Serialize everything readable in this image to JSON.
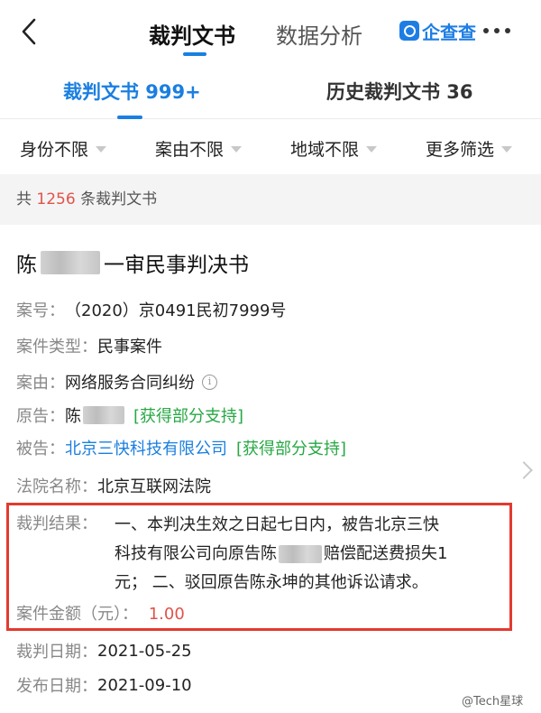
{
  "header": {
    "tabs": [
      {
        "label": "裁判文书"
      },
      {
        "label": "数据分析"
      }
    ],
    "logo_text": "企查查",
    "accent_color": "#1a7fe0"
  },
  "subtabs": [
    {
      "label": "裁判文书 999+"
    },
    {
      "label": "历史裁判文书 36"
    }
  ],
  "filters": [
    {
      "label": "身份不限"
    },
    {
      "label": "案由不限"
    },
    {
      "label": "地域不限"
    },
    {
      "label": "更多筛选"
    }
  ],
  "count_bar": {
    "prefix": "共",
    "count": "1256",
    "suffix": "条裁判文书"
  },
  "card": {
    "title_prefix": "陈",
    "title_suffix": "一审民事判决书",
    "case_no": {
      "label": "案号：",
      "value": "（2020）京0491民初7999号"
    },
    "case_type": {
      "label": "案件类型：",
      "value": "民事案件"
    },
    "cause": {
      "label": "案由：",
      "value": "网络服务合同纠纷",
      "icon": "info-icon"
    },
    "plaintiff": {
      "label": "原告：",
      "name": "陈",
      "tag": "[获得部分支持]"
    },
    "defendant": {
      "label": "被告：",
      "name": "北京三快科技有限公司",
      "tag": "[获得部分支持]"
    },
    "court": {
      "label": "法院名称：",
      "value": "北京互联网法院"
    },
    "result": {
      "label": "裁判结果：",
      "line1": "一、本判决生效之日起七日内，被告北京三快",
      "line2_a": "科技有限公司向原告陈",
      "line2_b": "赔偿配送费损失1",
      "line3": "元；  二、驳回原告陈永坤的其他诉讼请求。"
    },
    "amount": {
      "label": "案件金额（元）：",
      "value": "1.00"
    },
    "judgment_date": {
      "label": "裁判日期：",
      "value": "2021-05-25"
    },
    "publish_date": {
      "label": "发布日期：",
      "value": "2021-09-10"
    }
  },
  "watermark": "@Tech星球",
  "highlight_color": "#e23a2f"
}
